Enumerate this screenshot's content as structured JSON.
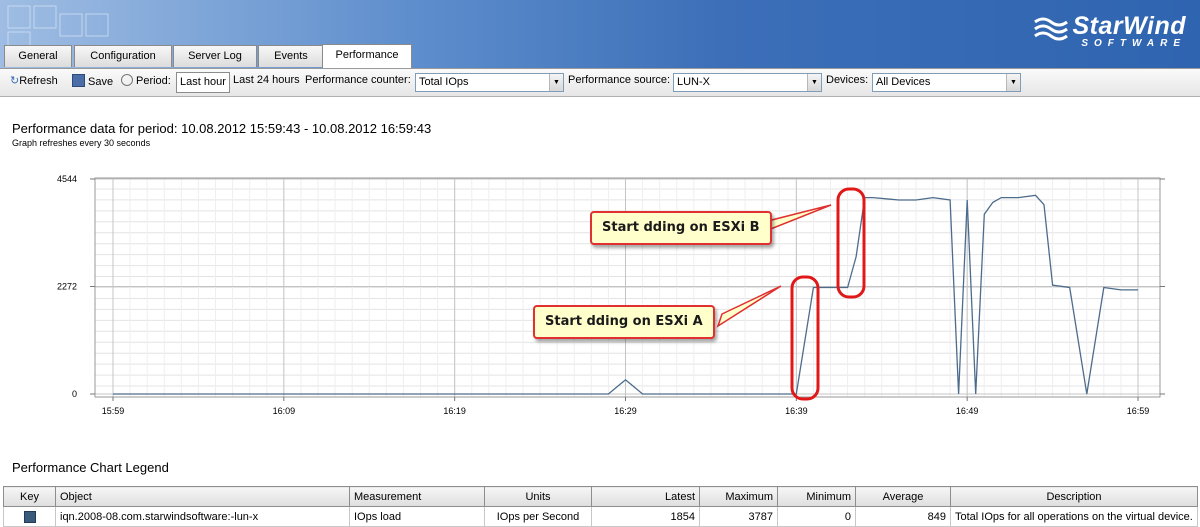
{
  "app": {
    "brand": "StarWind",
    "brand_sub": "SOFTWARE"
  },
  "tabs": [
    {
      "label": "General",
      "active": false
    },
    {
      "label": "Configuration",
      "active": false
    },
    {
      "label": "Server Log",
      "active": false
    },
    {
      "label": "Events",
      "active": false
    },
    {
      "label": "Performance",
      "active": true
    }
  ],
  "toolbar": {
    "refresh_label": "Refresh",
    "save_label": "Save",
    "period_label": "Period:",
    "last_hour_label": "Last hour",
    "last_24_label": "Last 24 hours",
    "counter_label": "Performance counter:",
    "counter_value": "Total IOps",
    "source_label": "Performance source:",
    "source_value": "LUN-X",
    "devices_label": "Devices:",
    "devices_value": "All Devices"
  },
  "page": {
    "title": "Performance data for period: 10.08.2012 15:59:43 - 10.08.2012 16:59:43",
    "subtitle": "Graph refreshes every 30 seconds",
    "legend_title": "Performance Chart Legend"
  },
  "annotations": {
    "a": "Start dding on ESXi A",
    "b": "Start dding on ESXi B"
  },
  "chart_data": {
    "type": "line",
    "y_ticks": [
      "4544",
      "2272",
      "0"
    ],
    "ylim": [
      0,
      4544
    ],
    "x_ticks": [
      "15:59",
      "16:09",
      "16:19",
      "16:29",
      "16:39",
      "16:49",
      "16:59"
    ],
    "xlim_minutes": [
      0,
      60
    ],
    "grid": true,
    "line_color": "#4d6c8c",
    "series": [
      {
        "x": [
          0,
          29,
          30,
          31,
          40,
          41,
          42,
          43,
          43.5,
          44,
          44.5,
          46,
          47,
          48,
          49,
          49.5,
          50,
          50.5,
          51,
          51.5,
          52,
          53,
          54,
          54.5,
          55,
          56,
          57,
          58,
          59,
          60
        ],
        "y": [
          0,
          0,
          300,
          0,
          0,
          2250,
          2250,
          2250,
          2900,
          4150,
          4150,
          4100,
          4100,
          4150,
          4100,
          0,
          4100,
          0,
          3800,
          4050,
          4150,
          4150,
          4200,
          4000,
          2300,
          2250,
          0,
          2250,
          2200,
          2200
        ]
      }
    ]
  },
  "legend": {
    "columns": [
      "Key",
      "Object",
      "Measurement",
      "Units",
      "Latest",
      "Maximum",
      "Minimum",
      "Average",
      "Description"
    ],
    "rows": [
      {
        "object": "iqn.2008-08.com.starwindsoftware:-lun-x",
        "measurement": "IOps load",
        "units": "IOps per Second",
        "latest": "1854",
        "maximum": "3787",
        "minimum": "0",
        "average": "849",
        "description": "Total IOps for all operations on the virtual device."
      }
    ],
    "swatch_color": "#3a5a7c"
  }
}
